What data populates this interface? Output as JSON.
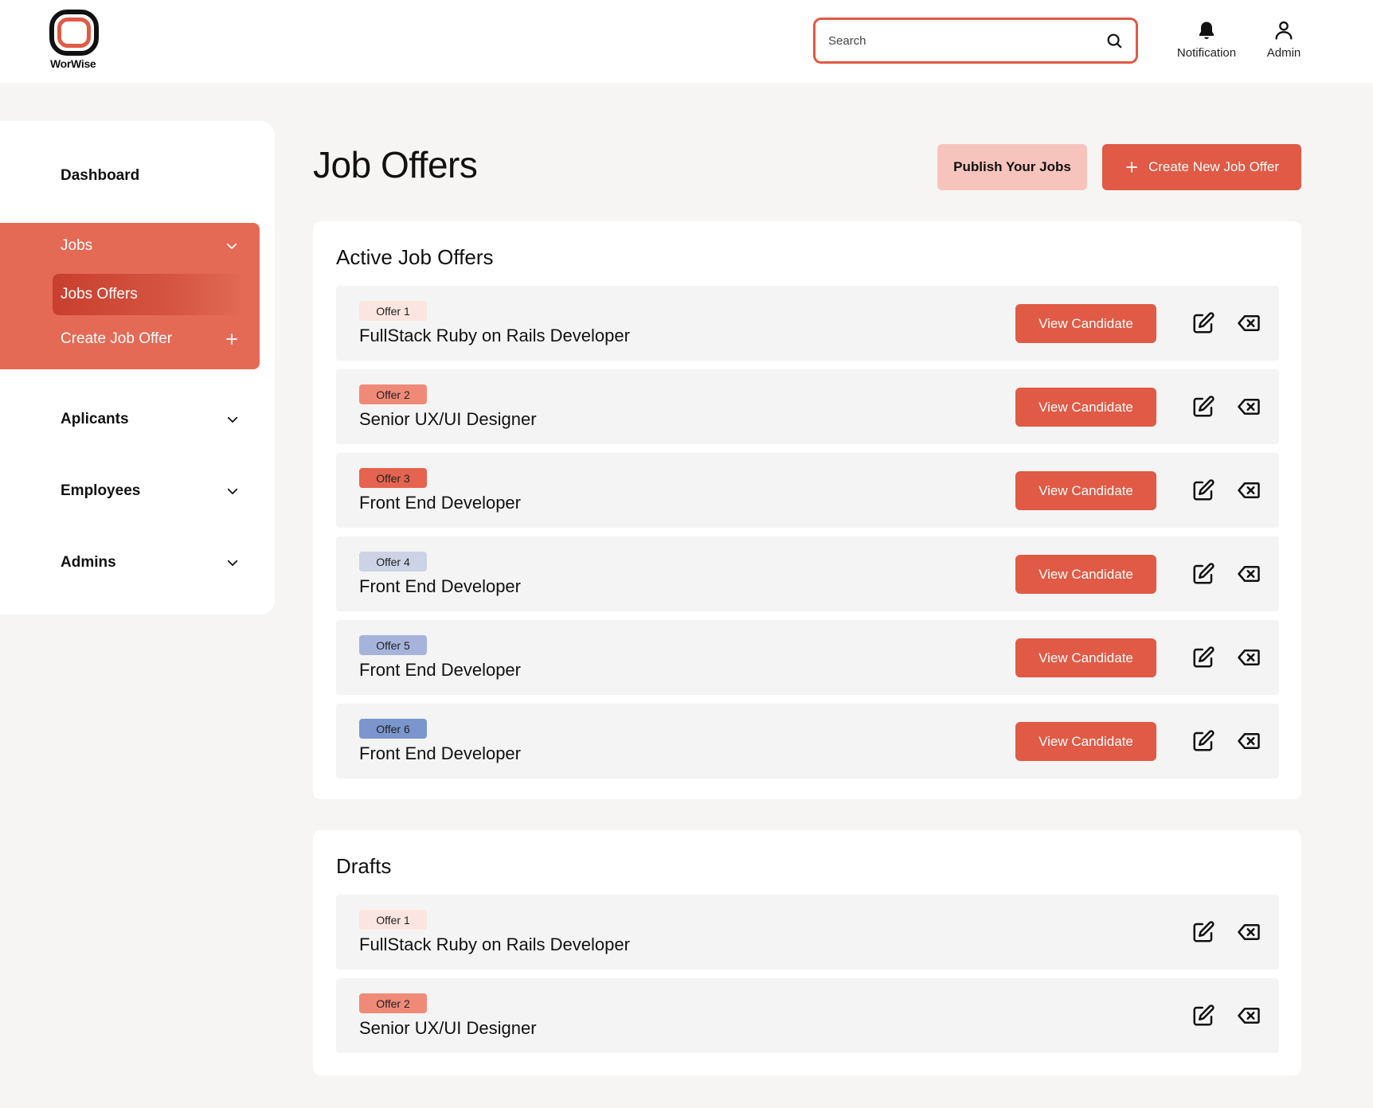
{
  "brand": {
    "name": "WorWise"
  },
  "search": {
    "placeholder": "Search"
  },
  "header": {
    "notification_label": "Notification",
    "admin_label": "Admin"
  },
  "sidebar": {
    "dashboard": "Dashboard",
    "jobs": "Jobs",
    "jobs_offers": "Jobs Offers",
    "create_job_offer": "Create Job Offer",
    "aplicants": "Aplicants",
    "employees": "Employees",
    "admins": "Admins"
  },
  "main": {
    "title": "Job Offers",
    "publish_label": "Publish Your Jobs",
    "create_label": "Create New Job Offer"
  },
  "active": {
    "title": "Active Job Offers",
    "view_label": "View Candidate",
    "rows": [
      {
        "badge": "Offer 1",
        "title": "FullStack Ruby on Rails Developer",
        "badge_color": "#fbe5e0"
      },
      {
        "badge": "Offer 2",
        "title": "Senior UX/UI Designer",
        "badge_color": "#f08a78"
      },
      {
        "badge": "Offer 3",
        "title": "Front End Developer",
        "badge_color": "#e46450"
      },
      {
        "badge": "Offer 4",
        "title": "Front End Developer",
        "badge_color": "#ccd3e6"
      },
      {
        "badge": "Offer 5",
        "title": "Front End Developer",
        "badge_color": "#a6b4dc"
      },
      {
        "badge": "Offer 6",
        "title": "Front End Developer",
        "badge_color": "#7b96cc"
      }
    ]
  },
  "drafts": {
    "title": "Drafts",
    "rows": [
      {
        "badge": "Offer 1",
        "title": "FullStack Ruby on Rails Developer",
        "badge_color": "#fbe5e0"
      },
      {
        "badge": "Offer 2",
        "title": "Senior UX/UI Designer",
        "badge_color": "#f08a78"
      }
    ]
  },
  "colors": {
    "accent": "#e05a45",
    "accent_light": "#f6c4bc",
    "sidebar_group": "#e46a56"
  }
}
